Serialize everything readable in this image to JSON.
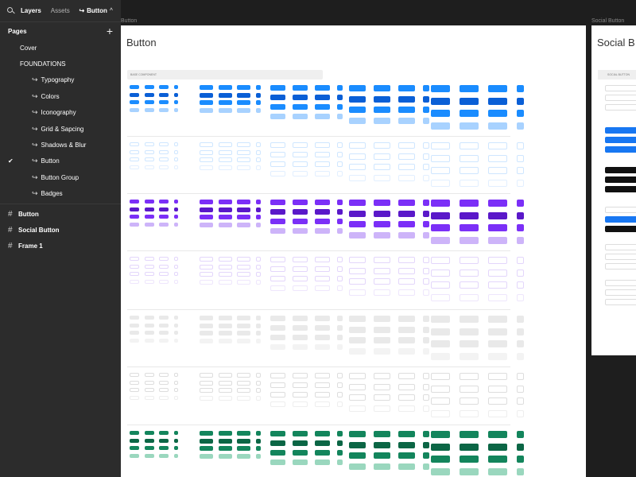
{
  "panel": {
    "tabs": [
      "Layers",
      "Assets"
    ],
    "page_picker": "Button",
    "pages_header": "Pages",
    "pages": [
      {
        "label": "Cover",
        "sub": false,
        "current": false
      },
      {
        "label": "FOUNDATIONS",
        "sub": false,
        "current": false
      },
      {
        "label": "Typography",
        "sub": true,
        "current": false
      },
      {
        "label": "Colors",
        "sub": true,
        "current": false
      },
      {
        "label": "Iconography",
        "sub": true,
        "current": false
      },
      {
        "label": "Grid & Sapcing",
        "sub": true,
        "current": false
      },
      {
        "label": "Shadows & Blur",
        "sub": true,
        "current": false
      },
      {
        "label": "Button",
        "sub": true,
        "current": true
      },
      {
        "label": "Button Group",
        "sub": true,
        "current": false
      },
      {
        "label": "Badges",
        "sub": true,
        "current": false
      }
    ],
    "layers": [
      "Button",
      "Social Button",
      "Frame 1"
    ]
  },
  "canvas": {
    "frames": [
      {
        "label": "Button",
        "title": "Button",
        "base_component_label": "BASE COMPONENT"
      },
      {
        "label": "Social Button",
        "title": "Social B",
        "section_label": "SOCIAL BUTTON"
      }
    ],
    "button_label": "Button",
    "colors": {
      "blue": "#1a8cff",
      "blue_dark": "#0a5fd6",
      "purple": "#7b2ff7",
      "purple_dark": "#5a18c9",
      "gray": "#e6e6e6",
      "green": "#13855c",
      "green_dark": "#0b6645"
    }
  }
}
